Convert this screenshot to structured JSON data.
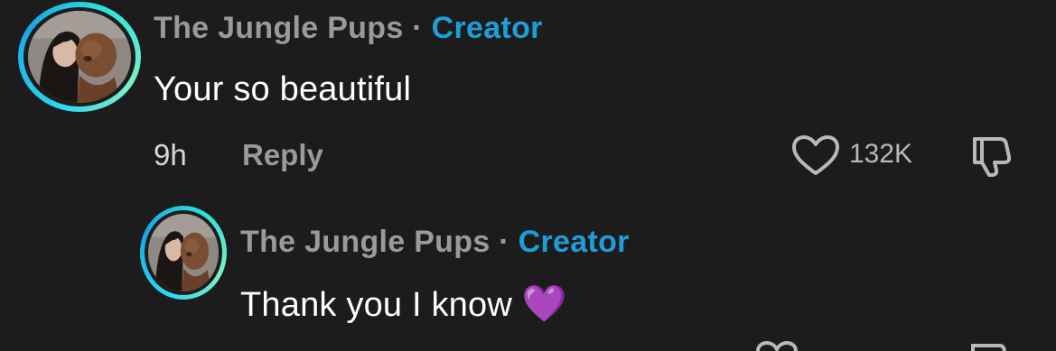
{
  "comment": {
    "author": "The Jungle Pups",
    "separator": "·",
    "role_badge": "Creator",
    "text": "Your so beautiful",
    "time": "9h",
    "reply_label": "Reply",
    "like_count": "132K",
    "icons": [
      "heart-icon",
      "dislike-icon"
    ]
  },
  "reply": {
    "author": "The Jungle Pups",
    "separator": "·",
    "role_badge": "Creator",
    "text": "Thank you I know",
    "emoji": "💜"
  },
  "colors": {
    "background": "#1c1c1d",
    "name_gray": "#9a9a9c",
    "creator_blue": "#1e9ed8",
    "ring_cyan": "#27d3f0",
    "heart_purple": "#9b4ce6"
  }
}
